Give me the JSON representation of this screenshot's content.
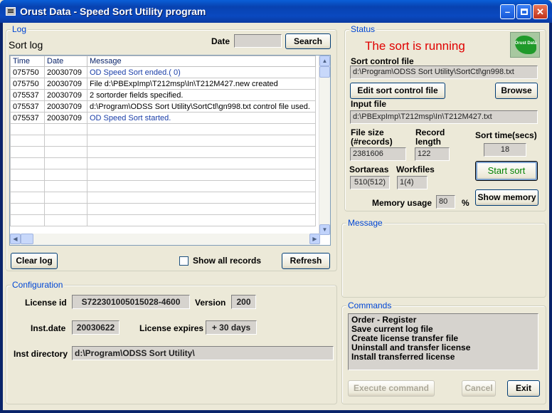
{
  "window": {
    "title": "Orust Data - Speed Sort Utility program",
    "buttons": [
      "minimize",
      "maximize",
      "close"
    ]
  },
  "log": {
    "group_title": "Log",
    "heading": "Sort log",
    "date_label": "Date",
    "date_value": "",
    "search_label": "Search",
    "columns": [
      "Time",
      "Date",
      "Message"
    ],
    "rows": [
      {
        "time": "075750",
        "date": "20030709",
        "message": "OD Speed Sort ended.( 0)",
        "color": "#1a3ea8"
      },
      {
        "time": "075750",
        "date": "20030709",
        "message": "File d:\\PBExpImp\\T212msp\\In\\T212M427.new created",
        "color": "#000000"
      },
      {
        "time": "075537",
        "date": "20030709",
        "message": "2 sortorder fields specified.",
        "color": "#000000"
      },
      {
        "time": "075537",
        "date": "20030709",
        "message": "d:\\Program\\ODSS Sort Utility\\SortCtl\\gn998.txt control file used.",
        "color": "#000000"
      },
      {
        "time": "075537",
        "date": "20030709",
        "message": "OD Speed Sort started.",
        "color": "#1a3ea8"
      }
    ],
    "clear_label": "Clear log",
    "show_all_label": "Show all records",
    "show_all_checked": false,
    "refresh_label": "Refresh"
  },
  "configuration": {
    "group_title": "Configuration",
    "license_id_label": "License id",
    "license_id": "S722301005015028-4600",
    "version_label": "Version",
    "version": "200",
    "inst_date_label": "Inst.date",
    "inst_date": "20030622",
    "license_expires_label": "License expires",
    "license_expires": "+ 30 days",
    "inst_dir_label": "Inst directory",
    "inst_dir": "d:\\Program\\ODSS Sort Utility\\"
  },
  "status": {
    "group_title": "Status",
    "state_text": "The sort is running",
    "state_color": "#e00000",
    "logo_text": "Orust Data",
    "sort_control_label": "Sort control file",
    "sort_control_file": "d:\\Program\\ODSS Sort Utility\\SortCtl\\gn998.txt",
    "edit_label": "Edit sort control file",
    "browse_label": "Browse",
    "input_label": "Input file",
    "input_file": "d:\\PBExpImp\\T212msp\\In\\T212M427.txt",
    "file_size_label_1": "File size",
    "file_size_label_2": "(#records)",
    "file_size": "2381606",
    "record_length_label_1": "Record",
    "record_length_label_2": "length",
    "record_length": "122",
    "sort_time_label": "Sort time(secs)",
    "sort_time": "18",
    "sortareas_label": "Sortareas",
    "sortareas": "510(512)",
    "workfiles_label": "Workfiles",
    "workfiles": "1(4)",
    "start_label": "Start sort",
    "start_color": "#008000",
    "memory_label": "Memory usage",
    "memory_value": "80",
    "memory_unit": "%",
    "show_memory_label": "Show memory"
  },
  "message": {
    "group_title": "Message",
    "text": ""
  },
  "commands": {
    "group_title": "Commands",
    "items": [
      "Order - Register",
      "Save current log file",
      "Create license transfer file",
      "Uninstall and transfer license",
      "Install transferred license"
    ],
    "execute_label": "Execute command",
    "cancel_label": "Cancel",
    "exit_label": "Exit"
  }
}
